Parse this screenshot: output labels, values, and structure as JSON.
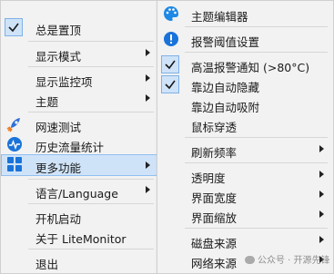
{
  "menu1": {
    "items": [
      {
        "label": "总是置顶",
        "checked": true
      },
      {
        "label": "显示模式",
        "submenu": true
      },
      {
        "label": "显示监控项",
        "submenu": true
      },
      {
        "label": "主题",
        "submenu": true
      },
      {
        "label": "网速测试",
        "icon": "rocket-icon"
      },
      {
        "label": "历史流量统计",
        "icon": "chart-icon"
      },
      {
        "label": "更多功能",
        "icon": "grid-icon",
        "submenu": true,
        "highlighted": true
      },
      {
        "label": "语言/Language",
        "submenu": true
      },
      {
        "label": "开机启动"
      },
      {
        "label": "关于 LiteMonitor"
      },
      {
        "label": "退出"
      }
    ]
  },
  "menu2": {
    "items": [
      {
        "label": "主题编辑器",
        "icon": "palette-icon"
      },
      {
        "label": "报警阈值设置",
        "icon": "alert-icon"
      },
      {
        "label": "高温报警通知 (>80°C)",
        "checked": true
      },
      {
        "label": "靠边自动隐藏",
        "checked": true
      },
      {
        "label": "靠边自动吸附"
      },
      {
        "label": "鼠标穿透"
      },
      {
        "label": "刷新频率",
        "submenu": true
      },
      {
        "label": "透明度",
        "submenu": true
      },
      {
        "label": "界面宽度",
        "submenu": true
      },
      {
        "label": "界面缩放",
        "submenu": true
      },
      {
        "label": "磁盘来源",
        "submenu": true
      },
      {
        "label": "网络来源",
        "submenu": true
      }
    ]
  },
  "watermark": "公众号 · 开源先锋",
  "colors": {
    "highlight": "#cfe3f8",
    "menu_bg": "#f2f2f2",
    "accent": "#1a73d9"
  }
}
